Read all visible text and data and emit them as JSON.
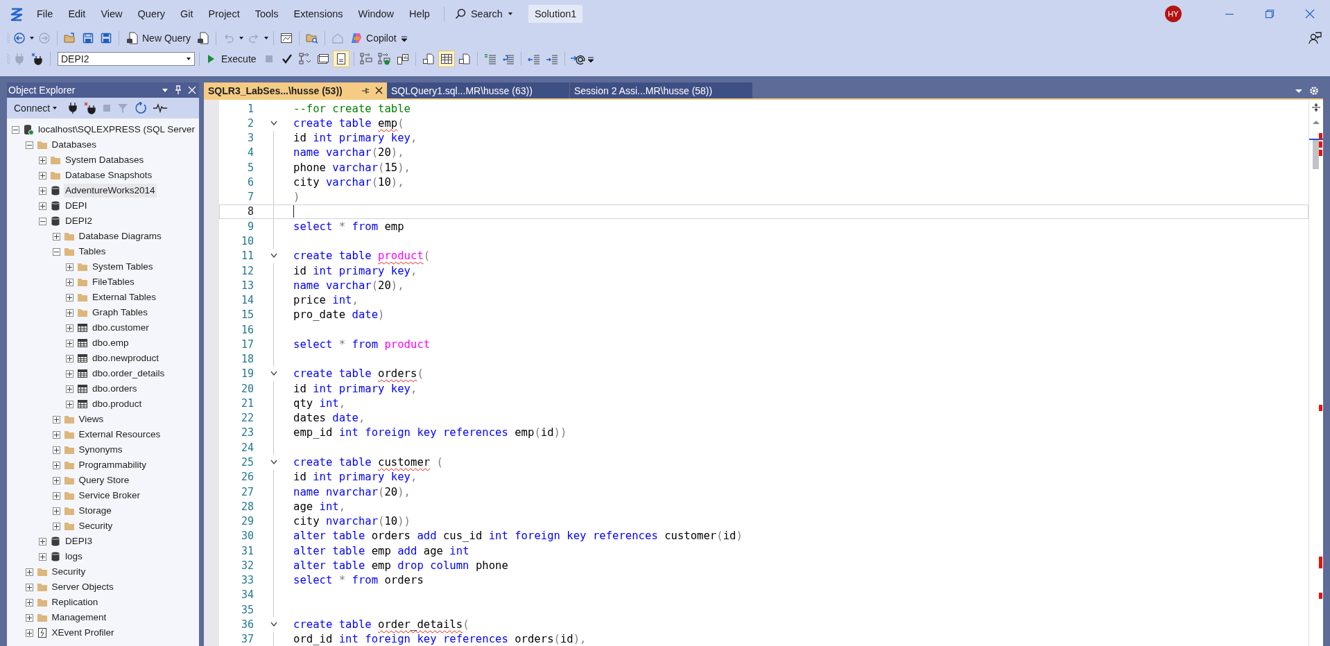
{
  "menu_bar": {
    "items": [
      "File",
      "Edit",
      "View",
      "Query",
      "Git",
      "Project",
      "Tools",
      "Extensions",
      "Window",
      "Help"
    ],
    "search": "Search",
    "solution": "Solution1",
    "avatar": "HY"
  },
  "standard_toolbar": {
    "new_query": "New Query",
    "copilot": "Copilot"
  },
  "query_toolbar": {
    "database": "DEPI2",
    "execute": "Execute",
    "results_toggles": [
      {
        "on": false
      },
      {
        "on": true
      }
    ],
    "plan_toggles": [
      {
        "on": false
      },
      {
        "on": true
      },
      {
        "on": false
      }
    ]
  },
  "object_explorer": {
    "title": "Object Explorer",
    "connect": "Connect",
    "tree": [
      {
        "label": "localhost\\SQLEXPRESS (SQL Server",
        "kind": "server",
        "expanded": true,
        "selected": false,
        "children": [
          {
            "label": "Databases",
            "kind": "folder",
            "expanded": true,
            "selected": false,
            "children": [
              {
                "label": "System Databases",
                "kind": "folder",
                "expanded": false,
                "selected": false
              },
              {
                "label": "Database Snapshots",
                "kind": "folder",
                "expanded": false,
                "selected": false
              },
              {
                "label": "AdventureWorks2014",
                "kind": "database",
                "expanded": false,
                "selected": true
              },
              {
                "label": "DEPI",
                "kind": "database",
                "expanded": false,
                "selected": false
              },
              {
                "label": "DEPI2",
                "kind": "database",
                "expanded": true,
                "selected": false,
                "children": [
                  {
                    "label": "Database Diagrams",
                    "kind": "folder",
                    "expanded": false,
                    "selected": false
                  },
                  {
                    "label": "Tables",
                    "kind": "folder",
                    "expanded": true,
                    "selected": false,
                    "children": [
                      {
                        "label": "System Tables",
                        "kind": "folder",
                        "expanded": false,
                        "selected": false
                      },
                      {
                        "label": "FileTables",
                        "kind": "folder",
                        "expanded": false,
                        "selected": false
                      },
                      {
                        "label": "External Tables",
                        "kind": "folder",
                        "expanded": false,
                        "selected": false
                      },
                      {
                        "label": "Graph Tables",
                        "kind": "folder",
                        "expanded": false,
                        "selected": false
                      },
                      {
                        "label": "dbo.customer",
                        "kind": "table",
                        "expanded": false,
                        "selected": false
                      },
                      {
                        "label": "dbo.emp",
                        "kind": "table",
                        "expanded": false,
                        "selected": false
                      },
                      {
                        "label": "dbo.newproduct",
                        "kind": "table",
                        "expanded": false,
                        "selected": false
                      },
                      {
                        "label": "dbo.order_details",
                        "kind": "table",
                        "expanded": false,
                        "selected": false
                      },
                      {
                        "label": "dbo.orders",
                        "kind": "table",
                        "expanded": false,
                        "selected": false
                      },
                      {
                        "label": "dbo.product",
                        "kind": "table",
                        "expanded": false,
                        "selected": false
                      }
                    ]
                  },
                  {
                    "label": "Views",
                    "kind": "folder",
                    "expanded": false,
                    "selected": false
                  },
                  {
                    "label": "External Resources",
                    "kind": "folder",
                    "expanded": false,
                    "selected": false
                  },
                  {
                    "label": "Synonyms",
                    "kind": "folder",
                    "expanded": false,
                    "selected": false
                  },
                  {
                    "label": "Programmability",
                    "kind": "folder",
                    "expanded": false,
                    "selected": false
                  },
                  {
                    "label": "Query Store",
                    "kind": "folder",
                    "expanded": false,
                    "selected": false
                  },
                  {
                    "label": "Service Broker",
                    "kind": "folder",
                    "expanded": false,
                    "selected": false
                  },
                  {
                    "label": "Storage",
                    "kind": "folder",
                    "expanded": false,
                    "selected": false
                  },
                  {
                    "label": "Security",
                    "kind": "folder",
                    "expanded": false,
                    "selected": false
                  }
                ]
              },
              {
                "label": "DEPI3",
                "kind": "database",
                "expanded": false,
                "selected": false
              },
              {
                "label": "logs",
                "kind": "database",
                "expanded": false,
                "selected": false
              }
            ]
          },
          {
            "label": "Security",
            "kind": "folder",
            "expanded": false,
            "selected": false
          },
          {
            "label": "Server Objects",
            "kind": "folder",
            "expanded": false,
            "selected": false
          },
          {
            "label": "Replication",
            "kind": "folder",
            "expanded": false,
            "selected": false
          },
          {
            "label": "Management",
            "kind": "folder",
            "expanded": false,
            "selected": false
          },
          {
            "label": "XEvent Profiler",
            "kind": "profiler",
            "expanded": false,
            "selected": false
          }
        ]
      }
    ]
  },
  "tabs": [
    {
      "label": "SQLR3_LabSes...\\husse (53))",
      "selected": true
    },
    {
      "label": "SQLQuery1.sql...MR\\husse (63))",
      "selected": false
    },
    {
      "label": "Session 2 Assi...MR\\husse (58))",
      "selected": false
    }
  ],
  "editor": {
    "lines": [
      {
        "number": "1",
        "fold": false,
        "current": false,
        "tokens": [
          {
            "kind": "comment",
            "text": "--for create table"
          }
        ]
      },
      {
        "number": "2",
        "fold": true,
        "current": false,
        "tokens": [
          {
            "kind": "keyword",
            "text": "create table "
          },
          {
            "kind": "plain-error",
            "text": "emp"
          },
          {
            "kind": "operator",
            "text": "("
          }
        ]
      },
      {
        "number": "3",
        "fold": false,
        "current": false,
        "tokens": [
          {
            "kind": "plain",
            "text": "id "
          },
          {
            "kind": "keyword",
            "text": "int primary key"
          },
          {
            "kind": "operator",
            "text": ","
          }
        ]
      },
      {
        "number": "4",
        "fold": false,
        "current": false,
        "tokens": [
          {
            "kind": "keyword",
            "text": "name varchar"
          },
          {
            "kind": "operator",
            "text": "("
          },
          {
            "kind": "plain",
            "text": "20"
          },
          {
            "kind": "operator",
            "text": "),"
          }
        ]
      },
      {
        "number": "5",
        "fold": false,
        "current": false,
        "tokens": [
          {
            "kind": "plain",
            "text": "phone "
          },
          {
            "kind": "keyword",
            "text": "varchar"
          },
          {
            "kind": "operator",
            "text": "("
          },
          {
            "kind": "plain",
            "text": "15"
          },
          {
            "kind": "operator",
            "text": "),"
          }
        ]
      },
      {
        "number": "6",
        "fold": false,
        "current": false,
        "tokens": [
          {
            "kind": "plain",
            "text": "city "
          },
          {
            "kind": "keyword",
            "text": "varchar"
          },
          {
            "kind": "operator",
            "text": "("
          },
          {
            "kind": "plain",
            "text": "10"
          },
          {
            "kind": "operator",
            "text": "),"
          }
        ]
      },
      {
        "number": "7",
        "fold": false,
        "current": false,
        "tokens": [
          {
            "kind": "operator",
            "text": ")"
          }
        ]
      },
      {
        "number": "8",
        "fold": false,
        "current": true
      },
      {
        "number": "9",
        "fold": false,
        "current": false,
        "tokens": [
          {
            "kind": "keyword",
            "text": "select "
          },
          {
            "kind": "operator",
            "text": "* "
          },
          {
            "kind": "keyword",
            "text": "from "
          },
          {
            "kind": "plain",
            "text": "emp"
          }
        ]
      },
      {
        "number": "10",
        "fold": false,
        "current": false
      },
      {
        "number": "11",
        "fold": true,
        "current": false,
        "tokens": [
          {
            "kind": "keyword",
            "text": "create table "
          },
          {
            "kind": "function-error",
            "text": "product"
          },
          {
            "kind": "operator",
            "text": "("
          }
        ]
      },
      {
        "number": "12",
        "fold": false,
        "current": false,
        "tokens": [
          {
            "kind": "plain",
            "text": "id "
          },
          {
            "kind": "keyword",
            "text": "int primary key"
          },
          {
            "kind": "operator",
            "text": ","
          }
        ]
      },
      {
        "number": "13",
        "fold": false,
        "current": false,
        "tokens": [
          {
            "kind": "keyword",
            "text": "name varchar"
          },
          {
            "kind": "operator",
            "text": "("
          },
          {
            "kind": "plain",
            "text": "20"
          },
          {
            "kind": "operator",
            "text": "),"
          }
        ]
      },
      {
        "number": "14",
        "fold": false,
        "current": false,
        "tokens": [
          {
            "kind": "plain",
            "text": "price "
          },
          {
            "kind": "keyword",
            "text": "int"
          },
          {
            "kind": "operator",
            "text": ","
          }
        ]
      },
      {
        "number": "15",
        "fold": false,
        "current": false,
        "tokens": [
          {
            "kind": "plain",
            "text": "pro_date "
          },
          {
            "kind": "keyword",
            "text": "date"
          },
          {
            "kind": "operator",
            "text": ")"
          }
        ]
      },
      {
        "number": "16",
        "fold": false,
        "current": false
      },
      {
        "number": "17",
        "fold": false,
        "current": false,
        "tokens": [
          {
            "kind": "keyword",
            "text": "select "
          },
          {
            "kind": "operator",
            "text": "* "
          },
          {
            "kind": "keyword",
            "text": "from "
          },
          {
            "kind": "function",
            "text": "product"
          }
        ]
      },
      {
        "number": "18",
        "fold": false,
        "current": false
      },
      {
        "number": "19",
        "fold": true,
        "current": false,
        "tokens": [
          {
            "kind": "keyword",
            "text": "create table "
          },
          {
            "kind": "plain-error",
            "text": "orders"
          },
          {
            "kind": "operator",
            "text": "("
          }
        ]
      },
      {
        "number": "20",
        "fold": false,
        "current": false,
        "tokens": [
          {
            "kind": "plain",
            "text": "id "
          },
          {
            "kind": "keyword",
            "text": "int primary key"
          },
          {
            "kind": "operator",
            "text": ","
          }
        ]
      },
      {
        "number": "21",
        "fold": false,
        "current": false,
        "tokens": [
          {
            "kind": "plain",
            "text": "qty "
          },
          {
            "kind": "keyword",
            "text": "int"
          },
          {
            "kind": "operator",
            "text": ","
          }
        ]
      },
      {
        "number": "22",
        "fold": false,
        "current": false,
        "tokens": [
          {
            "kind": "plain",
            "text": "dates "
          },
          {
            "kind": "keyword",
            "text": "date"
          },
          {
            "kind": "operator",
            "text": ","
          }
        ]
      },
      {
        "number": "23",
        "fold": false,
        "current": false,
        "tokens": [
          {
            "kind": "plain",
            "text": "emp_id "
          },
          {
            "kind": "keyword",
            "text": "int foreign key references "
          },
          {
            "kind": "plain",
            "text": "emp"
          },
          {
            "kind": "operator",
            "text": "("
          },
          {
            "kind": "plain",
            "text": "id"
          },
          {
            "kind": "operator",
            "text": "))"
          }
        ]
      },
      {
        "number": "24",
        "fold": false,
        "current": false
      },
      {
        "number": "25",
        "fold": true,
        "current": false,
        "tokens": [
          {
            "kind": "keyword",
            "text": "create table "
          },
          {
            "kind": "plain-error",
            "text": "customer"
          },
          {
            "kind": "operator",
            "text": " ("
          }
        ]
      },
      {
        "number": "26",
        "fold": false,
        "current": false,
        "tokens": [
          {
            "kind": "plain",
            "text": "id "
          },
          {
            "kind": "keyword",
            "text": "int primary key"
          },
          {
            "kind": "operator",
            "text": ","
          }
        ]
      },
      {
        "number": "27",
        "fold": false,
        "current": false,
        "tokens": [
          {
            "kind": "keyword",
            "text": "name nvarchar"
          },
          {
            "kind": "operator",
            "text": "("
          },
          {
            "kind": "plain",
            "text": "20"
          },
          {
            "kind": "operator",
            "text": "),"
          }
        ]
      },
      {
        "number": "28",
        "fold": false,
        "current": false,
        "tokens": [
          {
            "kind": "plain",
            "text": "age "
          },
          {
            "kind": "keyword",
            "text": "int"
          },
          {
            "kind": "operator",
            "text": ","
          }
        ]
      },
      {
        "number": "29",
        "fold": false,
        "current": false,
        "tokens": [
          {
            "kind": "plain",
            "text": "city "
          },
          {
            "kind": "keyword",
            "text": "nvarchar"
          },
          {
            "kind": "operator",
            "text": "("
          },
          {
            "kind": "plain",
            "text": "10"
          },
          {
            "kind": "operator",
            "text": "))"
          }
        ]
      },
      {
        "number": "30",
        "fold": false,
        "current": false,
        "tokens": [
          {
            "kind": "keyword",
            "text": "alter table "
          },
          {
            "kind": "plain",
            "text": "orders "
          },
          {
            "kind": "keyword",
            "text": "add "
          },
          {
            "kind": "plain",
            "text": "cus_id "
          },
          {
            "kind": "keyword",
            "text": "int foreign key references "
          },
          {
            "kind": "plain",
            "text": "customer"
          },
          {
            "kind": "operator",
            "text": "("
          },
          {
            "kind": "plain",
            "text": "id"
          },
          {
            "kind": "operator",
            "text": ")"
          }
        ]
      },
      {
        "number": "31",
        "fold": false,
        "current": false,
        "tokens": [
          {
            "kind": "keyword",
            "text": "alter table "
          },
          {
            "kind": "plain",
            "text": "emp "
          },
          {
            "kind": "keyword",
            "text": "add "
          },
          {
            "kind": "plain",
            "text": "age "
          },
          {
            "kind": "keyword",
            "text": "int"
          }
        ]
      },
      {
        "number": "32",
        "fold": false,
        "current": false,
        "tokens": [
          {
            "kind": "keyword",
            "text": "alter table "
          },
          {
            "kind": "plain",
            "text": "emp "
          },
          {
            "kind": "keyword",
            "text": "drop column "
          },
          {
            "kind": "plain",
            "text": "phone"
          }
        ]
      },
      {
        "number": "33",
        "fold": false,
        "current": false,
        "tokens": [
          {
            "kind": "keyword",
            "text": "select "
          },
          {
            "kind": "operator",
            "text": "* "
          },
          {
            "kind": "keyword",
            "text": "from "
          },
          {
            "kind": "plain",
            "text": "orders"
          }
        ]
      },
      {
        "number": "34",
        "fold": false,
        "current": false
      },
      {
        "number": "35",
        "fold": false,
        "current": false
      },
      {
        "number": "36",
        "fold": true,
        "current": false,
        "tokens": [
          {
            "kind": "keyword",
            "text": "create table "
          },
          {
            "kind": "plain-error",
            "text": "order_details"
          },
          {
            "kind": "operator",
            "text": "("
          }
        ]
      },
      {
        "number": "37",
        "fold": false,
        "current": false,
        "tokens": [
          {
            "kind": "plain",
            "text": "ord_id "
          },
          {
            "kind": "keyword",
            "text": "int foreign key references "
          },
          {
            "kind": "plain",
            "text": "orders"
          },
          {
            "kind": "operator",
            "text": "("
          },
          {
            "kind": "plain",
            "text": "id"
          },
          {
            "kind": "operator",
            "text": "),"
          }
        ]
      }
    ]
  }
}
